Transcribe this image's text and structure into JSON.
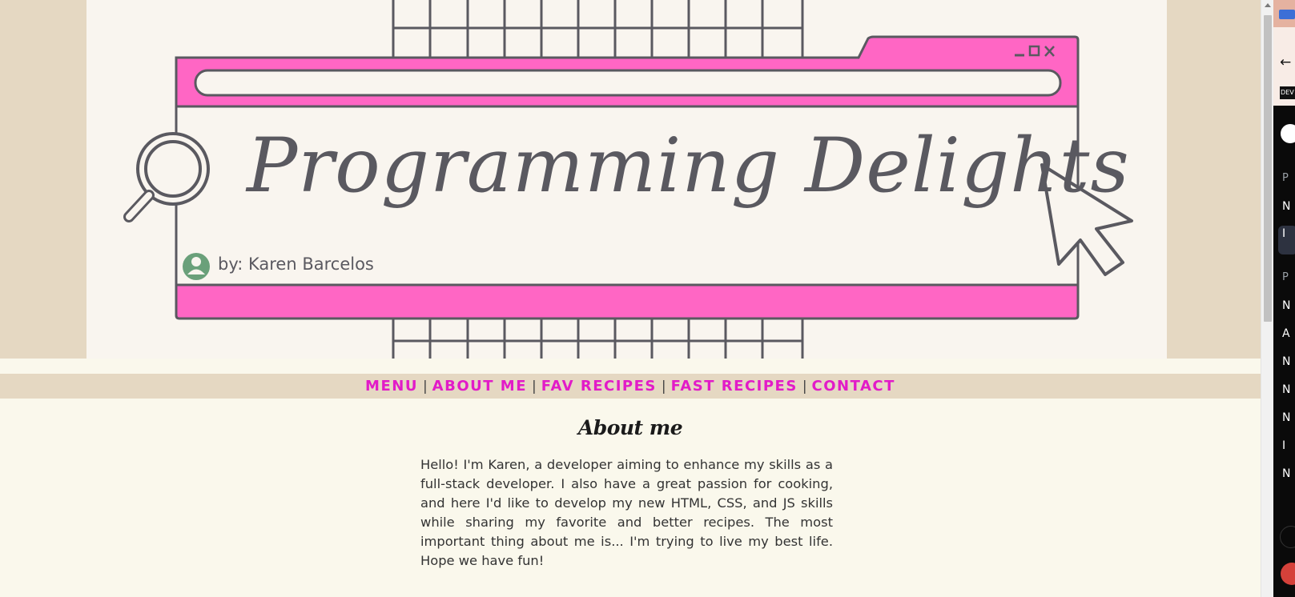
{
  "banner": {
    "title": "Programming Delights",
    "byline": "by: Karen Barcelos",
    "colors": {
      "pink": "#ff66c4",
      "ink": "#5a5960",
      "avatar": "#6aa07a",
      "paper": "#f9f5ef",
      "outer": "#e5d8c2"
    }
  },
  "nav": {
    "items": [
      {
        "label": "MENU"
      },
      {
        "label": "ABOUT ME"
      },
      {
        "label": "FAV RECIPES"
      },
      {
        "label": "FAST RECIPES"
      },
      {
        "label": "CONTACT"
      }
    ],
    "separator": "|",
    "color": "#e21bc8"
  },
  "about": {
    "title": "About me",
    "text": "Hello! I'm Karen, a developer aiming to enhance my skills as a full-stack developer. I also have a great passion for cooking, and here I'd like to develop my new HTML, CSS, and JS skills while sharing my favorite and better recipes. The most important thing about me is... I'm trying to live my best life. Hope we have fun!"
  },
  "side_panel": {
    "dev_badge": "DEV",
    "letters": [
      "P",
      "N",
      "I",
      "P",
      "N",
      "A",
      "N",
      "N",
      "N",
      "I",
      "N"
    ]
  }
}
